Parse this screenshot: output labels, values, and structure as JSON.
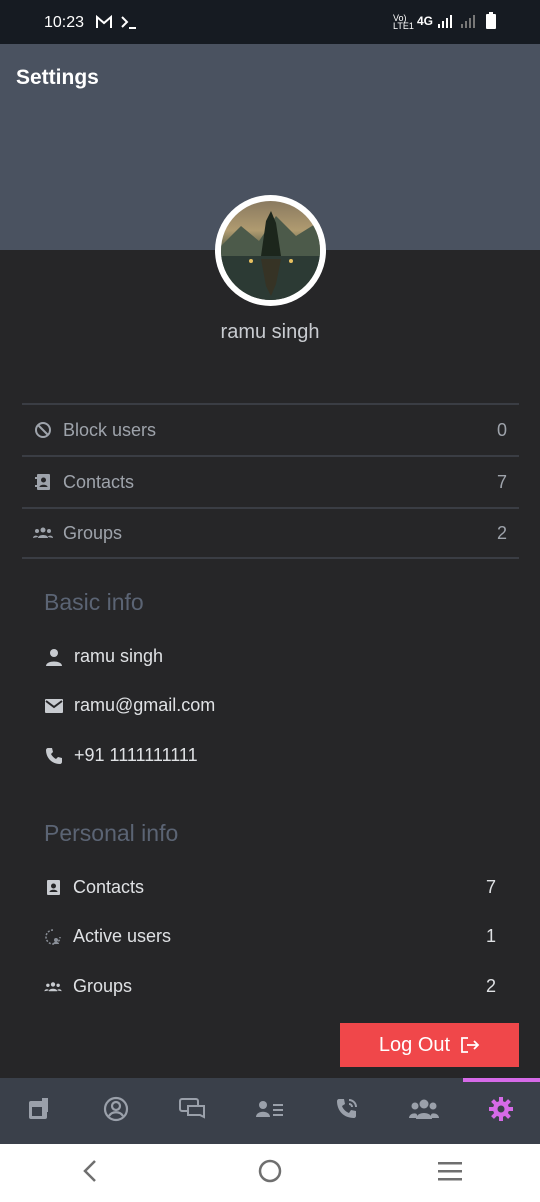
{
  "status_bar": {
    "time": "10:23",
    "network": "4G"
  },
  "header": {
    "title": "Settings"
  },
  "profile": {
    "name": "ramu singh"
  },
  "stats": [
    {
      "icon": "block-icon",
      "label": "Block users",
      "value": "0"
    },
    {
      "icon": "contacts-book-icon",
      "label": "Contacts",
      "value": "7"
    },
    {
      "icon": "groups-icon",
      "label": "Groups",
      "value": "2"
    }
  ],
  "basic_info": {
    "title": "Basic info",
    "name": "ramu singh",
    "email": "ramu@gmail.com",
    "phone": "+91 1111111111"
  },
  "personal_info": {
    "title": "Personal info",
    "items": [
      {
        "icon": "contacts-book-icon",
        "label": "Contacts",
        "value": "7"
      },
      {
        "icon": "active-users-icon",
        "label": "Active users",
        "value": "1"
      },
      {
        "icon": "groups-icon",
        "label": "Groups",
        "value": "2"
      }
    ]
  },
  "logout": {
    "label": "Log Out"
  },
  "bottom_nav": {
    "tabs": [
      "home-icon",
      "profile-icon",
      "chats-icon",
      "contacts-list-icon",
      "calls-icon",
      "groups-icon",
      "settings-icon"
    ],
    "active": "settings-icon",
    "active_color": "#d66ae8"
  },
  "colors": {
    "header_bg": "#4a5260",
    "body_bg": "#262628",
    "logout_bg": "#f0474a"
  }
}
